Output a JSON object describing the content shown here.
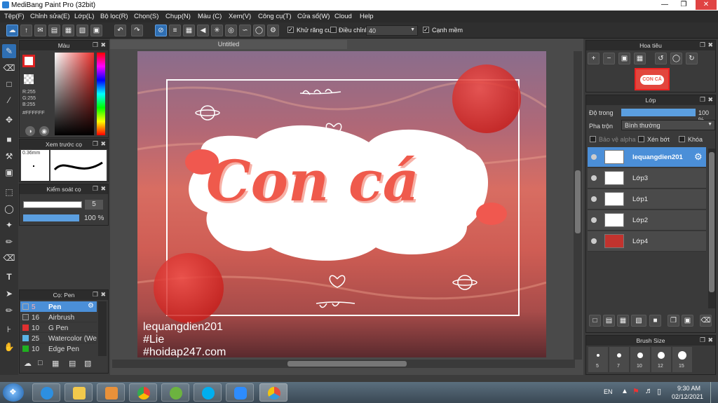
{
  "app": {
    "title": "MediBang Paint Pro (32bit)"
  },
  "menu": [
    "Tệp(F)",
    "Chỉnh sửa(E)",
    "Lớp(L)",
    "Bộ lọc(R)",
    "Chọn(S)",
    "Chụp(N)",
    "Màu (C)",
    "Xem(V)",
    "Công cụ(T)",
    "Cửa sổ(W)",
    "Cloud",
    "Help"
  ],
  "toolbar": {
    "antialias_label": "Khử răng cưa",
    "adjust_label": "Điều chỉnh",
    "adjust_value": "40",
    "sharp_label": "Cạnh mềm"
  },
  "color_panel": {
    "title": "Màu",
    "r": "R:255",
    "g": "G:255",
    "b": "B:255",
    "hex": "#FFFFFF"
  },
  "brush_preview": {
    "title": "Xem trước cọ",
    "size": "0.36mm"
  },
  "brush_control": {
    "title": "Kiểm soát cọ",
    "size_value": "5",
    "opacity_value": "100 %"
  },
  "brush_list": {
    "title": "Cọ: Pen",
    "items": [
      {
        "size": "5",
        "name": "Pen",
        "color": "#444444"
      },
      {
        "size": "16",
        "name": "Airbrush",
        "color": "#444444"
      },
      {
        "size": "10",
        "name": "G Pen",
        "color": "#e03030"
      },
      {
        "size": "25",
        "name": "Watercolor (Wet",
        "color": "#5ab4e6"
      },
      {
        "size": "10",
        "name": "Edge Pen",
        "color": "#20b020"
      }
    ]
  },
  "canvas": {
    "tab": "Untitled",
    "artwork_title": "Con cá",
    "watermark": [
      "lequangdien201",
      "#Lie",
      "#hoidap247.com"
    ]
  },
  "navigator": {
    "title": "Hoa tiêu",
    "thumb_label": "CON CÁ"
  },
  "layers_panel": {
    "title": "Lớp",
    "opacity_label": "Độ trong",
    "opacity_value": "100 %",
    "blend_label": "Pha trộn",
    "blend_value": "Bình thường",
    "protect_alpha": "Bảo vệ alpha",
    "clipping": "Xén bớt",
    "lock": "Khóa",
    "layers": [
      {
        "name": "lequangdien201",
        "selected": true
      },
      {
        "name": "Lớp3",
        "selected": false
      },
      {
        "name": "Lớp1",
        "selected": false
      },
      {
        "name": "Lớp2",
        "selected": false
      },
      {
        "name": "Lớp4",
        "selected": false
      }
    ]
  },
  "brush_size": {
    "title": "Brush Size",
    "sizes": [
      "5",
      "7",
      "10",
      "12",
      "15"
    ]
  },
  "taskbar": {
    "lang": "EN",
    "time": "9:30 AM",
    "date": "02/12/2021"
  }
}
